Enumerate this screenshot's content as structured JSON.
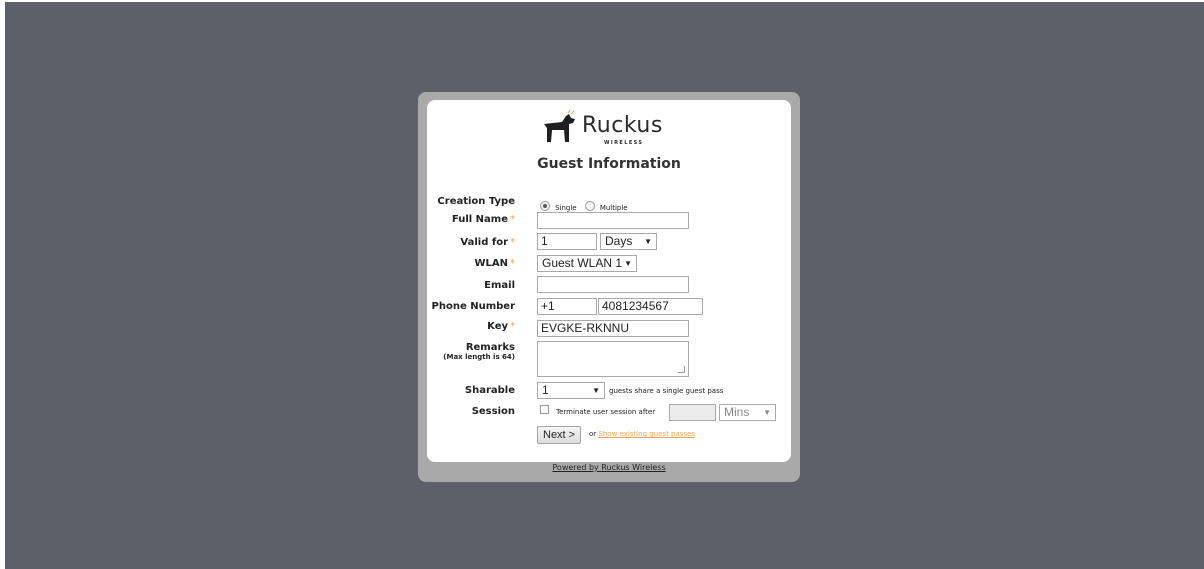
{
  "brand": {
    "name": "Ruckus",
    "sub": "WIRELESS"
  },
  "form": {
    "title": "Guest Information",
    "creation_type": {
      "label": "Creation Type",
      "options": [
        "Single",
        "Multiple"
      ],
      "selected": "Single"
    },
    "full_name": {
      "label": "Full Name",
      "value": ""
    },
    "valid_for": {
      "label": "Valid for",
      "value": "1",
      "unit": "Days"
    },
    "wlan": {
      "label": "WLAN",
      "value": "Guest WLAN 1"
    },
    "email": {
      "label": "Email",
      "value": ""
    },
    "phone": {
      "label": "Phone Number",
      "country_code": "+1",
      "number": "4081234567"
    },
    "key": {
      "label": "Key",
      "value": "EVGKE-RKNNU"
    },
    "remarks": {
      "label": "Remarks",
      "hint": "(Max length is 64)",
      "value": ""
    },
    "sharable": {
      "label": "Sharable",
      "value": "1",
      "suffix": "guests share a single guest pass"
    },
    "session": {
      "label": "Session",
      "checkbox_label": "Terminate user session after",
      "value": "",
      "unit": "Mins"
    },
    "next_label": "Next >",
    "or_text": "or",
    "show_existing": "Show existing guest passes"
  },
  "required_mark": "*",
  "footer": {
    "powered_by": "Powered by Ruckus Wireless"
  },
  "colors": {
    "background": "#5c6169",
    "accent": "#f2a24b",
    "frame": "#a9a9a9"
  }
}
